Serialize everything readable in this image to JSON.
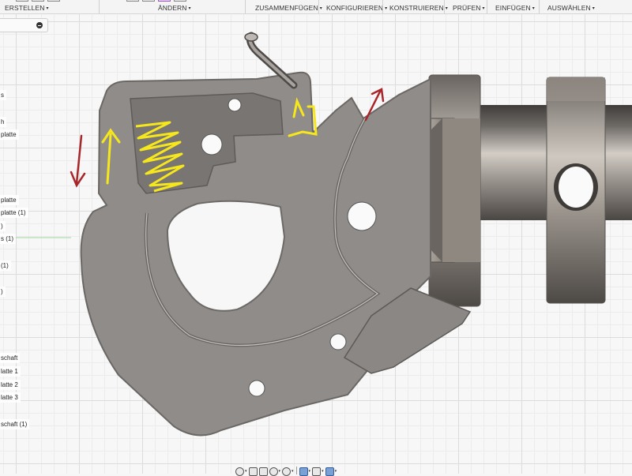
{
  "toolbar": {
    "menus": [
      {
        "label": "ERSTELLEN",
        "caret": "▾"
      },
      {
        "label": "ÄNDERN",
        "caret": "▾"
      },
      {
        "label": "ZUSAMMENFÜGEN",
        "caret": "▾"
      },
      {
        "label": "KONFIGURIEREN",
        "caret": "▾"
      },
      {
        "label": "KONSTRUIEREN",
        "caret": "▾"
      },
      {
        "label": "PRÜFEN",
        "caret": "▾"
      },
      {
        "label": "EINFÜGEN",
        "caret": "▾"
      },
      {
        "label": "AUSWÄHLEN",
        "caret": "▾"
      }
    ]
  },
  "browser": {
    "collapse_icon": "minus-circle-icon",
    "items": [
      "s",
      "h",
      "platte",
      "platte",
      "platte (1)",
      ")",
      "s (1)",
      "(1)",
      ")",
      "schaft",
      "latte 1",
      "latte 2",
      "latte 3",
      "schaft (1)"
    ]
  },
  "navbar": {
    "icons": [
      "orbit-icon",
      "pan-icon",
      "look-at-icon",
      "zoom-window-icon",
      "fit-icon",
      "display-style-icon",
      "grid-icon",
      "viewports-icon"
    ]
  },
  "annotations": {
    "yellow": "#f6e71c",
    "red": "#a8262a"
  },
  "colors": {
    "part_face": "#8d8a87",
    "part_edge": "#6e6b68",
    "shaft_dark": "#5c5855",
    "shaft_light": "#c9c3bc"
  }
}
